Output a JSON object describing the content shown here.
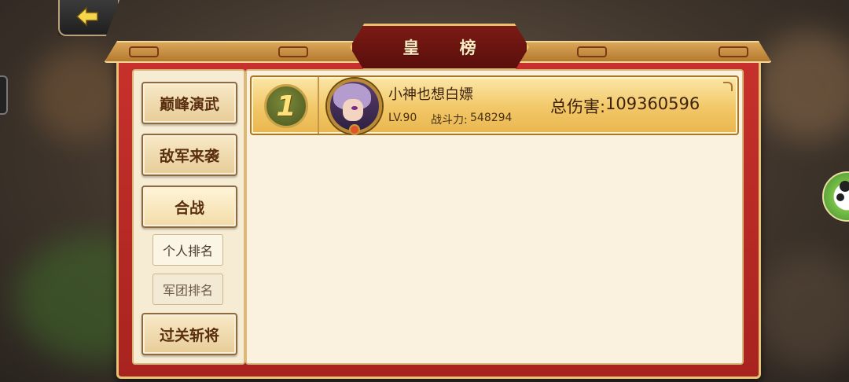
{
  "window": {
    "title": "皇  榜"
  },
  "navigation": {
    "back_icon": "back-arrow-icon",
    "tabs": [
      {
        "label": "巅峰演武",
        "active": false
      },
      {
        "label": "敌军来袭",
        "active": false
      },
      {
        "label": "合战",
        "active": true
      },
      {
        "label": "过关斩将",
        "active": false
      }
    ],
    "subtabs": [
      {
        "label": "个人排名",
        "active": true
      },
      {
        "label": "军团排名",
        "active": false
      }
    ]
  },
  "rankings": [
    {
      "rank": "1",
      "name": "小神也想白嫖",
      "level": "LV.90",
      "power_label": "战斗力:",
      "power": "548294",
      "damage_label": "总伤害:",
      "damage": "109360596"
    }
  ],
  "colors": {
    "frame_red": "#c8312c",
    "gold_trim": "#e7c277",
    "title_bg": "#7b1a14",
    "panel_bg": "#faf2df",
    "row_gold": "#f2c767",
    "text_brown": "#3d220c"
  }
}
